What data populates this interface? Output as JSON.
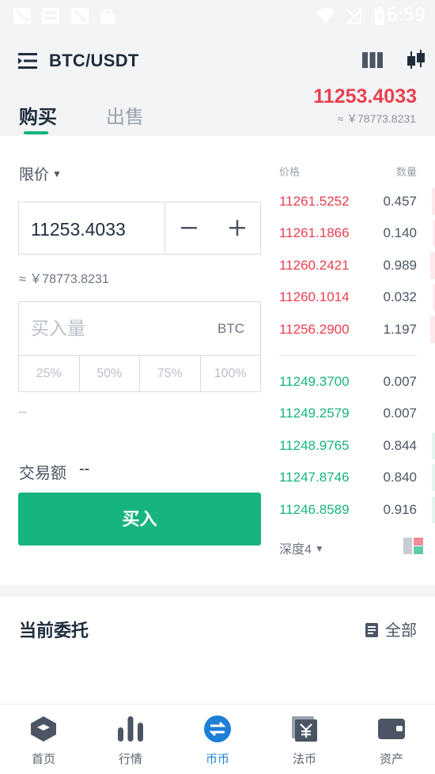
{
  "status_bar": {
    "time": "6:59"
  },
  "header": {
    "pair": "BTC/USDT",
    "tabs": {
      "buy": "购买",
      "sell": "出售"
    },
    "last_price": "11253.4033",
    "last_price_cny": "≈ ￥78773.8231"
  },
  "order_form": {
    "order_type": "限价",
    "price_value": "11253.4033",
    "price_cny": "≈ ￥78773.8231",
    "minus_label": "−",
    "plus_label": "+",
    "amount_placeholder": "买入量",
    "amount_unit": "BTC",
    "percent_options": [
      "25%",
      "50%",
      "75%",
      "100%"
    ],
    "available": "--",
    "trade_amount_label": "交易额",
    "trade_amount_value": "--",
    "buy_button": "买入"
  },
  "order_book": {
    "price_header": "价格",
    "qty_header": "数量",
    "asks": [
      {
        "price": "11261.5252",
        "qty": "0.457",
        "depth": 0.02
      },
      {
        "price": "11261.1866",
        "qty": "0.140",
        "depth": 0.01
      },
      {
        "price": "11260.2421",
        "qty": "0.989",
        "depth": 0.03
      },
      {
        "price": "11260.1014",
        "qty": "0.032",
        "depth": 0.01
      },
      {
        "price": "11256.2900",
        "qty": "1.197",
        "depth": 0.03
      }
    ],
    "bids": [
      {
        "price": "11249.3700",
        "qty": "0.007",
        "depth": 0.0
      },
      {
        "price": "11249.2579",
        "qty": "0.007",
        "depth": 0.0
      },
      {
        "price": "11248.9765",
        "qty": "0.844",
        "depth": 0.02
      },
      {
        "price": "11247.8746",
        "qty": "0.840",
        "depth": 0.02
      },
      {
        "price": "11246.8589",
        "qty": "0.916",
        "depth": 0.02
      }
    ],
    "depth_label": "深度4"
  },
  "entrust": {
    "title": "当前委托",
    "all_label": "全部"
  },
  "tabbar": [
    {
      "label": "首页",
      "icon": "home-icon"
    },
    {
      "label": "行情",
      "icon": "market-icon"
    },
    {
      "label": "币币",
      "icon": "exchange-icon",
      "active": true
    },
    {
      "label": "法币",
      "icon": "fiat-icon"
    },
    {
      "label": "资产",
      "icon": "wallet-icon"
    }
  ],
  "colors": {
    "accent_green": "#16b57f",
    "accent_red": "#e8404f",
    "active_blue": "#1d7fd6"
  }
}
